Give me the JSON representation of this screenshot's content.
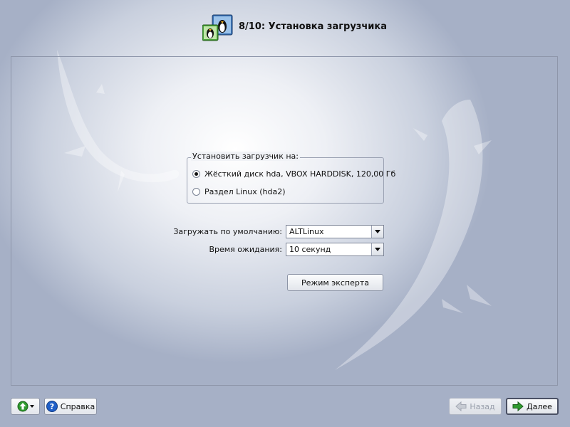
{
  "header": {
    "title": "8/10: Установка загрузчика"
  },
  "bootloader_group": {
    "legend": "Установить загрузчик на:",
    "options": [
      {
        "label": "Жёсткий диск hda, VBOX HARDDISK, 120,00 Гб",
        "checked": true
      },
      {
        "label": "Раздел Linux (hda2)",
        "checked": false
      }
    ]
  },
  "default_boot": {
    "label": "Загружать по умолчанию:",
    "value": "ALTLinux"
  },
  "timeout": {
    "label": "Время ожидания:",
    "value": "10 секунд"
  },
  "expert_button": {
    "label": "Режим эксперта"
  },
  "footer": {
    "menu_button_icon": "green-up-arrow-icon",
    "help_label": "Справка",
    "back_label": "Назад",
    "back_enabled": false,
    "next_label": "Далее"
  },
  "colors": {
    "accent_green": "#2e9a2e",
    "help_blue": "#1f5fc8"
  }
}
